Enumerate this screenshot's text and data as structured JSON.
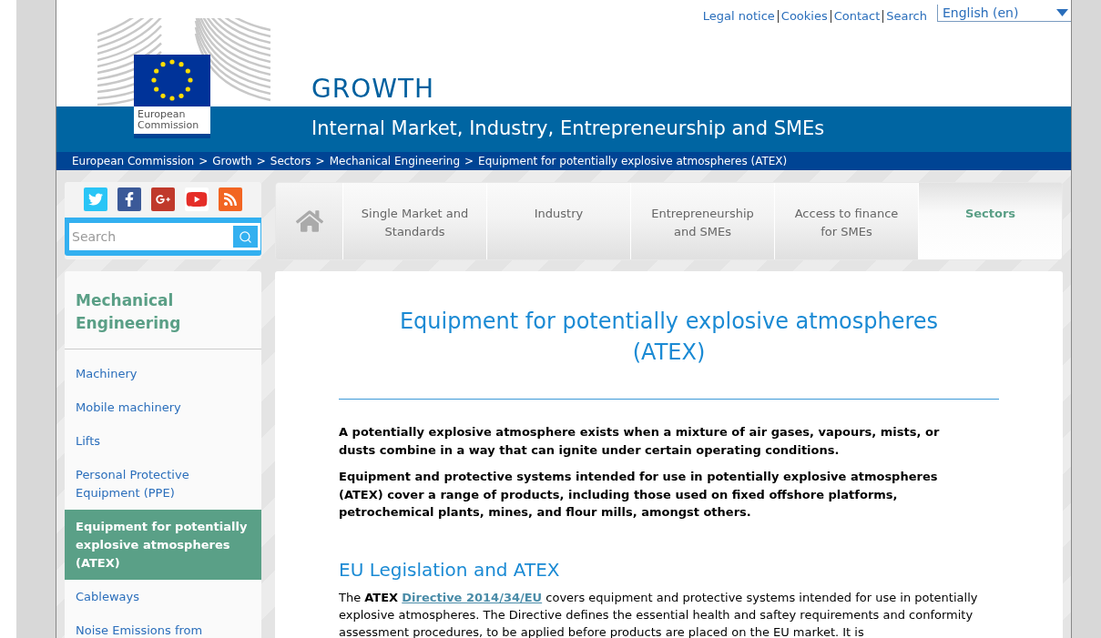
{
  "top_links": [
    "Legal notice",
    "Cookies",
    "Contact",
    "Search"
  ],
  "language_select": {
    "value": "English (en)"
  },
  "logo": {
    "label": "European Commission"
  },
  "site": {
    "title": "GROWTH",
    "subtitle": "Internal Market, Industry, Entrepreneurship and SMEs"
  },
  "breadcrumb": {
    "separator": ">",
    "items": [
      "European Commission",
      "Growth",
      "Sectors",
      "Mechanical Engineering",
      "Equipment for potentially explosive atmospheres (ATEX)"
    ]
  },
  "social": [
    {
      "kind": "twitter"
    },
    {
      "kind": "facebook"
    },
    {
      "kind": "googleplus"
    },
    {
      "kind": "youtube"
    },
    {
      "kind": "rss"
    }
  ],
  "search": {
    "placeholder": "Search"
  },
  "nav_tabs": [
    {
      "label": "Single Market and Standards",
      "selected": false
    },
    {
      "label": "Industry",
      "selected": false
    },
    {
      "label": "Entrepreneurship and SMEs",
      "selected": false
    },
    {
      "label": "Access to finance for SMEs",
      "selected": false
    },
    {
      "label": "Sectors",
      "selected": true
    }
  ],
  "sidebar": {
    "title": "Mechanical Engineering",
    "items": [
      {
        "label": "Machinery",
        "selected": false
      },
      {
        "label": "Mobile machinery",
        "selected": false
      },
      {
        "label": "Lifts",
        "selected": false
      },
      {
        "label": "Personal Protective Equipment (PPE)",
        "selected": false
      },
      {
        "label": "Equipment for potentially explosive atmospheres (ATEX)",
        "selected": true
      },
      {
        "label": "Cableways",
        "selected": false
      },
      {
        "label": "Noise Emissions from",
        "selected": false
      }
    ]
  },
  "content": {
    "title": "Equipment for potentially explosive atmospheres (ATEX)",
    "intro": [
      "A potentially explosive atmosphere exists when a mixture of air gases, vapours, mists, or dusts combine in a way that can ignite under certain operating conditions.",
      "Equipment and protective systems intended for use in potentially explosive atmospheres (ATEX) cover a range of products, including those used on fixed offshore platforms, petrochemical plants, mines, and flour mills, amongst others."
    ],
    "section_heading": "EU Legislation and ATEX",
    "paragraph": {
      "before": "The **ATEX**",
      "link": "Directive 2014/34/EU",
      "after": "covers equipment and protective systems intended for use in potentially explosive atmospheres. The Directive defines the essential health and saftey requirements and conformity assessment procedures, to be applied before products are placed on the EU market. It is"
    }
  }
}
